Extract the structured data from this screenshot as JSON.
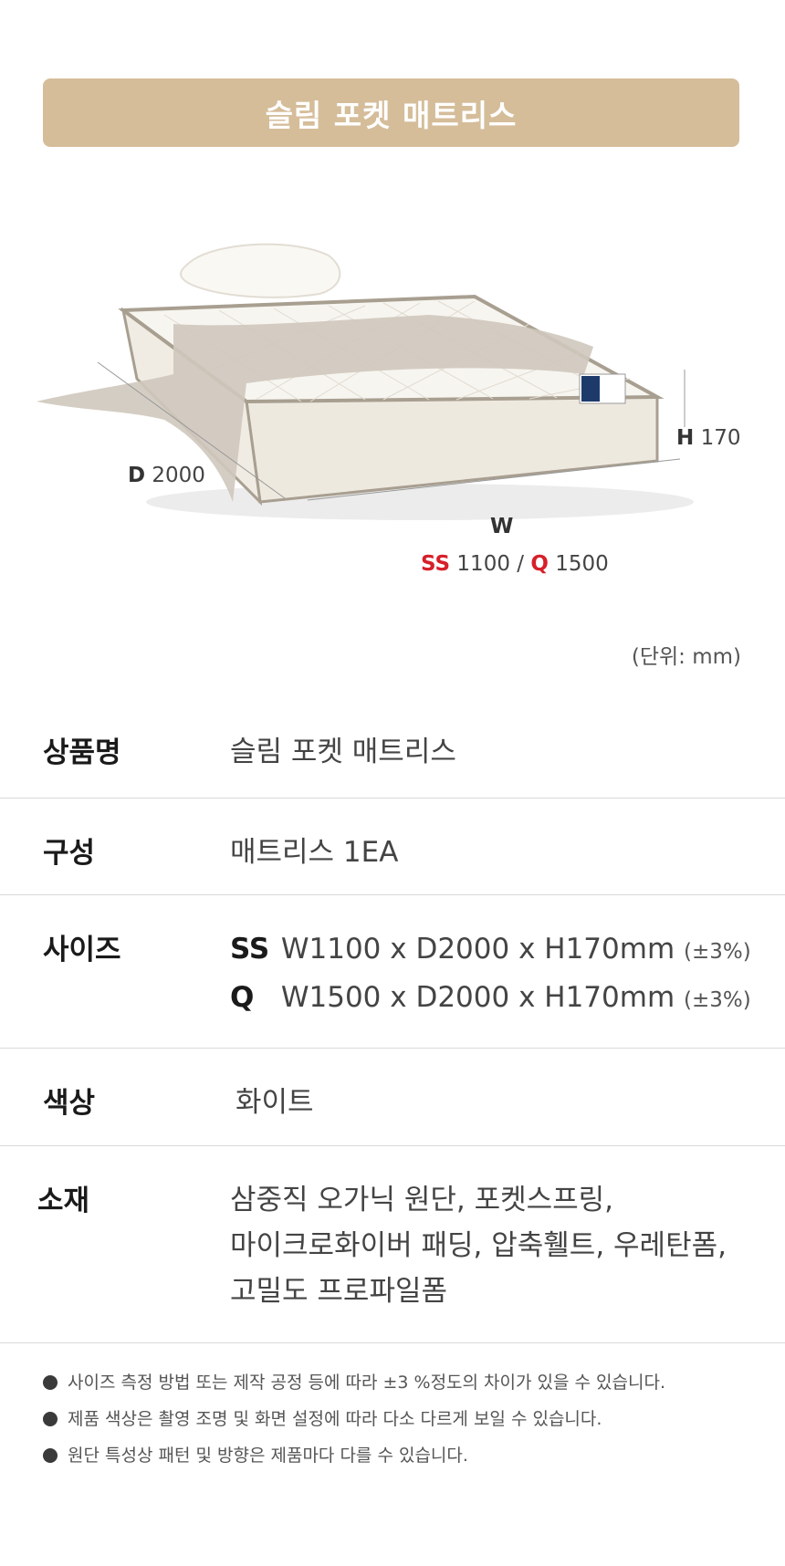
{
  "header": {
    "title": "슬림 포켓 매트리스"
  },
  "dimensions": {
    "depth_key": "D",
    "depth_value": "2000",
    "height_key": "H",
    "height_value": "170",
    "width_key": "W",
    "ss_key": "SS",
    "ss_value": "1100",
    "slash": "/",
    "q_key": "Q",
    "q_value": "1500",
    "accent_color": "#d6202a"
  },
  "unit_note": "(단위: mm)",
  "specs": {
    "name": {
      "label": "상품명",
      "value": "슬림 포켓 매트리스"
    },
    "composition": {
      "label": "구성",
      "value": "매트리스 1EA"
    },
    "size": {
      "label": "사이즈",
      "rows": [
        {
          "key": "SS",
          "value": "W1100 x D2000 x H170mm",
          "tolerance": "(±3%)"
        },
        {
          "key": "Q",
          "value": "W1500 x D2000 x H170mm",
          "tolerance": "(±3%)"
        }
      ]
    },
    "color": {
      "label": "색상",
      "value": "화이트"
    },
    "material": {
      "label": "소재",
      "lines": [
        "삼중직 오가닉 원단, 포켓스프링,",
        "마이크로화이버 패딩, 압축휄트, 우레탄폼,",
        "고밀도 프로파일폼"
      ]
    }
  },
  "notes": [
    "사이즈 측정 방법 또는 제작 공정 등에 따라 ±3 %정도의 차이가 있을 수 있습니다.",
    "제품 색상은 촬영 조명 및 화면 설정에 따라 다소 다르게 보일 수 있습니다.",
    "원단 특성상 패턴 및 방향은 제품마다 다를 수 있습니다."
  ],
  "colors": {
    "title_bar": "#d5bd9a",
    "divider": "#d9d9d9"
  }
}
